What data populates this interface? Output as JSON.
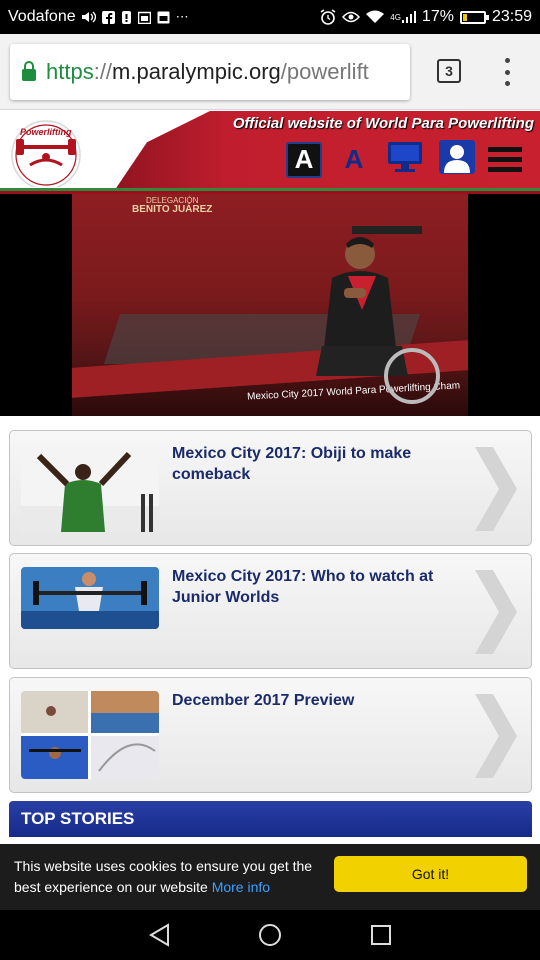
{
  "status_bar": {
    "carrier": "Vodafone",
    "battery_percent": "17%",
    "time": "23:59",
    "network": "4G",
    "battery_level": 0.17
  },
  "browser": {
    "url_scheme": "https",
    "url_sep": "://",
    "url_host": "m.paralympic.org",
    "url_path": "/powerlift",
    "tab_count": "3"
  },
  "site": {
    "logo_text": "Powerlifting",
    "header_title": "Official website of World Para Powerlifting",
    "font_large": "A",
    "font_small": "A",
    "colors": {
      "header_red": "#c8202f",
      "stripe_green": "#2f8a3b",
      "title_blue": "#1a2a6b"
    }
  },
  "hero": {
    "banner_text_line1": "DELEGACIÓN",
    "banner_text_line2": "BENITO JUÁREZ",
    "band_text": "Mexico City 2017 World Para Powerlifting Cham"
  },
  "news": [
    {
      "title": "Mexico City 2017: Obiji to make comeback"
    },
    {
      "title": "Mexico City 2017: Who to watch at Junior Worlds"
    },
    {
      "title": "December 2017 Preview"
    }
  ],
  "section_header": "TOP STORIES",
  "cookie": {
    "text": "This website uses cookies to ensure you get the best experience on our website",
    "link": "More info",
    "button": "Got it!"
  }
}
